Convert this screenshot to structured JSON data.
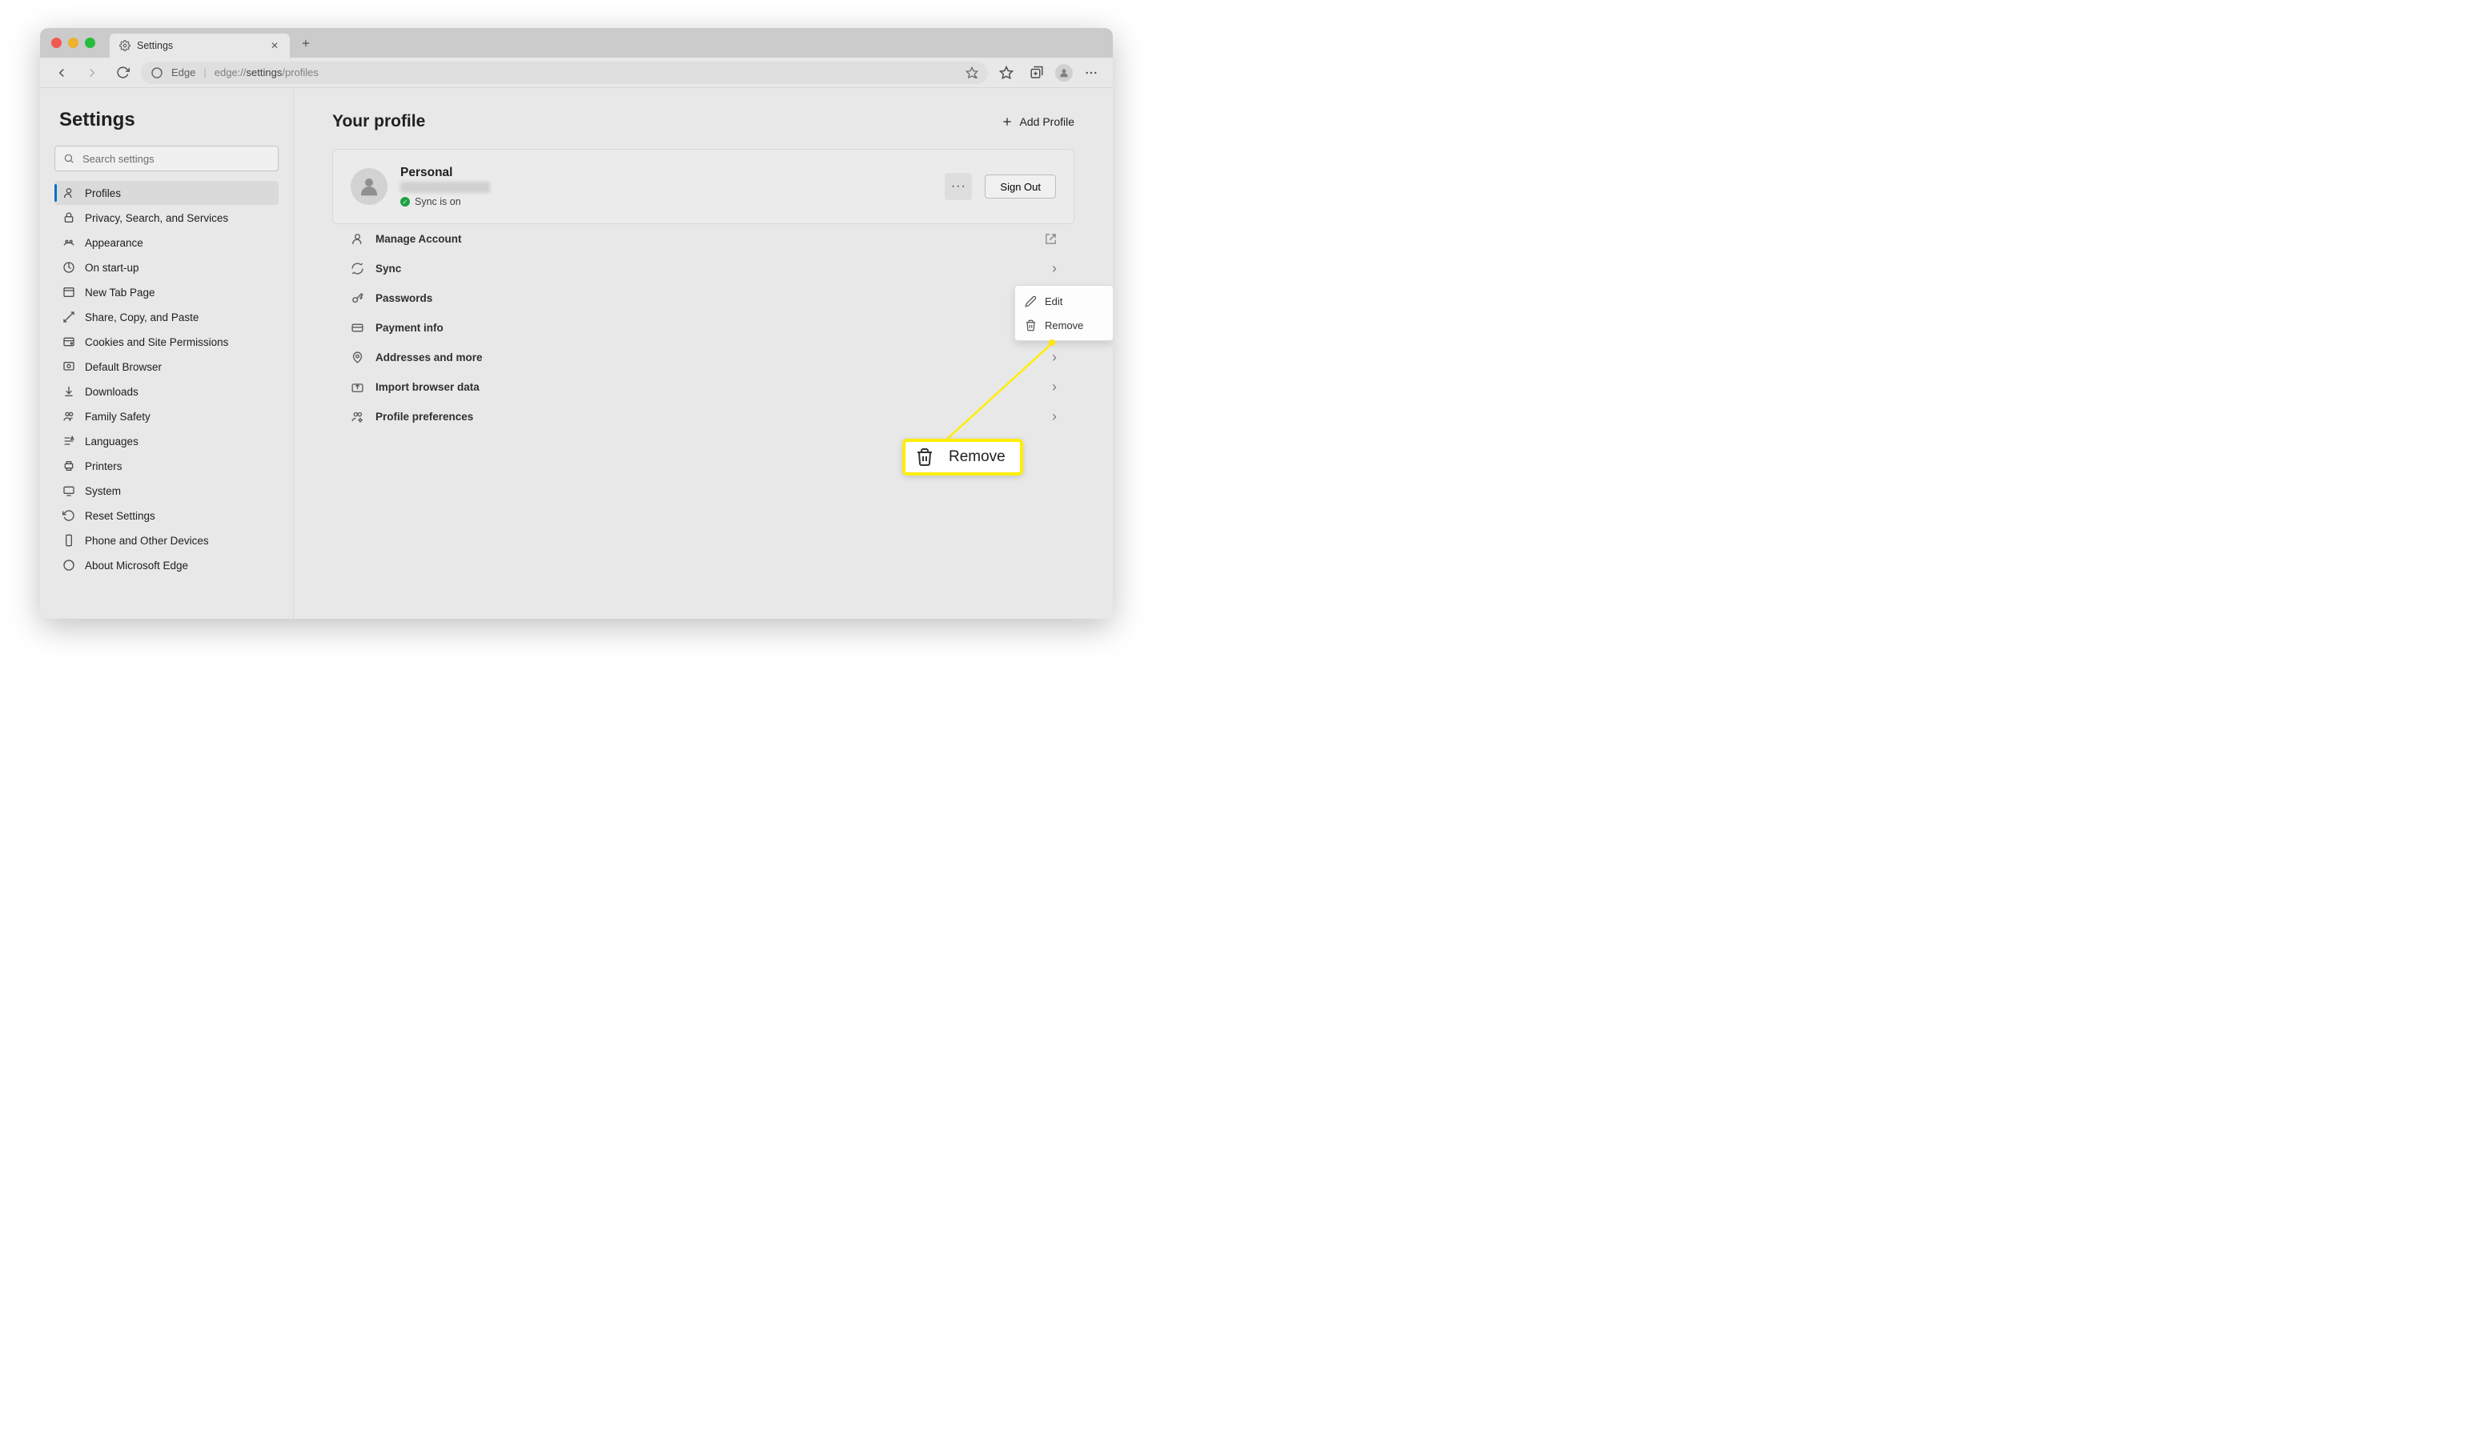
{
  "window": {
    "tab_title": "Settings"
  },
  "addressbar": {
    "label": "Edge",
    "url_prefix": "edge://",
    "url_bold": "settings",
    "url_suffix": "/profiles"
  },
  "sidebar": {
    "title": "Settings",
    "search_placeholder": "Search settings",
    "items": [
      {
        "label": "Profiles"
      },
      {
        "label": "Privacy, Search, and Services"
      },
      {
        "label": "Appearance"
      },
      {
        "label": "On start-up"
      },
      {
        "label": "New Tab Page"
      },
      {
        "label": "Share, Copy, and Paste"
      },
      {
        "label": "Cookies and Site Permissions"
      },
      {
        "label": "Default Browser"
      },
      {
        "label": "Downloads"
      },
      {
        "label": "Family Safety"
      },
      {
        "label": "Languages"
      },
      {
        "label": "Printers"
      },
      {
        "label": "System"
      },
      {
        "label": "Reset Settings"
      },
      {
        "label": "Phone and Other Devices"
      },
      {
        "label": "About Microsoft Edge"
      }
    ]
  },
  "main": {
    "title": "Your profile",
    "add_profile": "Add Profile",
    "profile": {
      "name": "Personal",
      "sync_status": "Sync is on",
      "sign_out": "Sign Out"
    },
    "rows": [
      {
        "label": "Manage Account"
      },
      {
        "label": "Sync"
      },
      {
        "label": "Passwords"
      },
      {
        "label": "Payment info"
      },
      {
        "label": "Addresses and more"
      },
      {
        "label": "Import browser data"
      },
      {
        "label": "Profile preferences"
      }
    ]
  },
  "context_menu": {
    "edit": "Edit",
    "remove": "Remove"
  },
  "callout": {
    "label": "Remove"
  }
}
